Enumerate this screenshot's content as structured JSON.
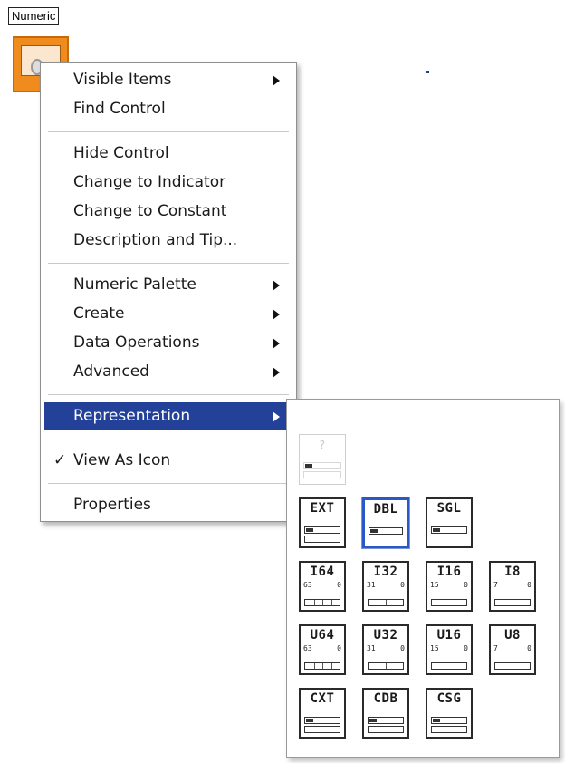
{
  "control": {
    "label": "Numeric"
  },
  "context_menu": {
    "groups": [
      [
        {
          "label": "Visible Items",
          "submenu": true
        },
        {
          "label": "Find Control",
          "submenu": false
        }
      ],
      [
        {
          "label": "Hide Control",
          "submenu": false
        },
        {
          "label": "Change to Indicator",
          "submenu": false
        },
        {
          "label": "Change to Constant",
          "submenu": false
        },
        {
          "label": "Description and Tip...",
          "submenu": false
        }
      ],
      [
        {
          "label": "Numeric Palette",
          "submenu": true
        },
        {
          "label": "Create",
          "submenu": true
        },
        {
          "label": "Data Operations",
          "submenu": true
        },
        {
          "label": "Advanced",
          "submenu": true
        }
      ],
      [
        {
          "label": "Representation",
          "submenu": true,
          "selected": true
        }
      ],
      [
        {
          "label": "View As Icon",
          "submenu": false,
          "checked": true
        }
      ],
      [
        {
          "label": "Properties",
          "submenu": false
        }
      ]
    ],
    "check_glyph": "✓"
  },
  "representation_palette": {
    "rows": [
      [
        {
          "code": "?",
          "state": "disabled"
        }
      ],
      [
        {
          "code": "EXT",
          "state": "normal"
        },
        {
          "code": "DBL",
          "state": "selected"
        },
        {
          "code": "SGL",
          "state": "normal"
        }
      ],
      [
        {
          "code": "I64",
          "state": "normal",
          "range": [
            "63",
            "0"
          ]
        },
        {
          "code": "I32",
          "state": "normal",
          "range": [
            "31",
            "0"
          ]
        },
        {
          "code": "I16",
          "state": "normal",
          "range": [
            "15",
            "0"
          ]
        },
        {
          "code": "I8",
          "state": "normal",
          "range": [
            "7",
            "0"
          ]
        }
      ],
      [
        {
          "code": "U64",
          "state": "normal",
          "range": [
            "63",
            "0"
          ]
        },
        {
          "code": "U32",
          "state": "normal",
          "range": [
            "31",
            "0"
          ]
        },
        {
          "code": "U16",
          "state": "normal",
          "range": [
            "15",
            "0"
          ]
        },
        {
          "code": "U8",
          "state": "normal",
          "range": [
            "7",
            "0"
          ]
        }
      ],
      [
        {
          "code": "CXT",
          "state": "normal"
        },
        {
          "code": "CDB",
          "state": "normal"
        },
        {
          "code": "CSG",
          "state": "normal"
        }
      ]
    ]
  },
  "colors": {
    "selection": "#24419a",
    "terminal_orange": "#f08c1e",
    "selected_tile_border": "#2a58c8"
  }
}
